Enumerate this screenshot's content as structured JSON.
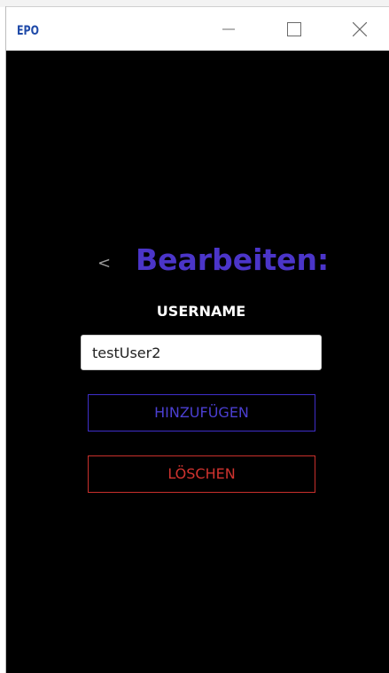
{
  "window": {
    "app_logo_text": "EPO",
    "buttons": {
      "minimize_icon": "minimize-icon",
      "maximize_icon": "maximize-icon",
      "close_icon": "close-icon"
    }
  },
  "page": {
    "back_label": "<",
    "title": "Bearbeiten:",
    "username_label": "USERNAME",
    "username_value": "testUser2",
    "add_button_label": "HINZUFÜGEN",
    "delete_button_label": "LÖSCHEN"
  },
  "colors": {
    "title": "#4b35c9",
    "add_button": "#4b3fd1",
    "delete_button": "#d0332f",
    "background": "#000000"
  }
}
